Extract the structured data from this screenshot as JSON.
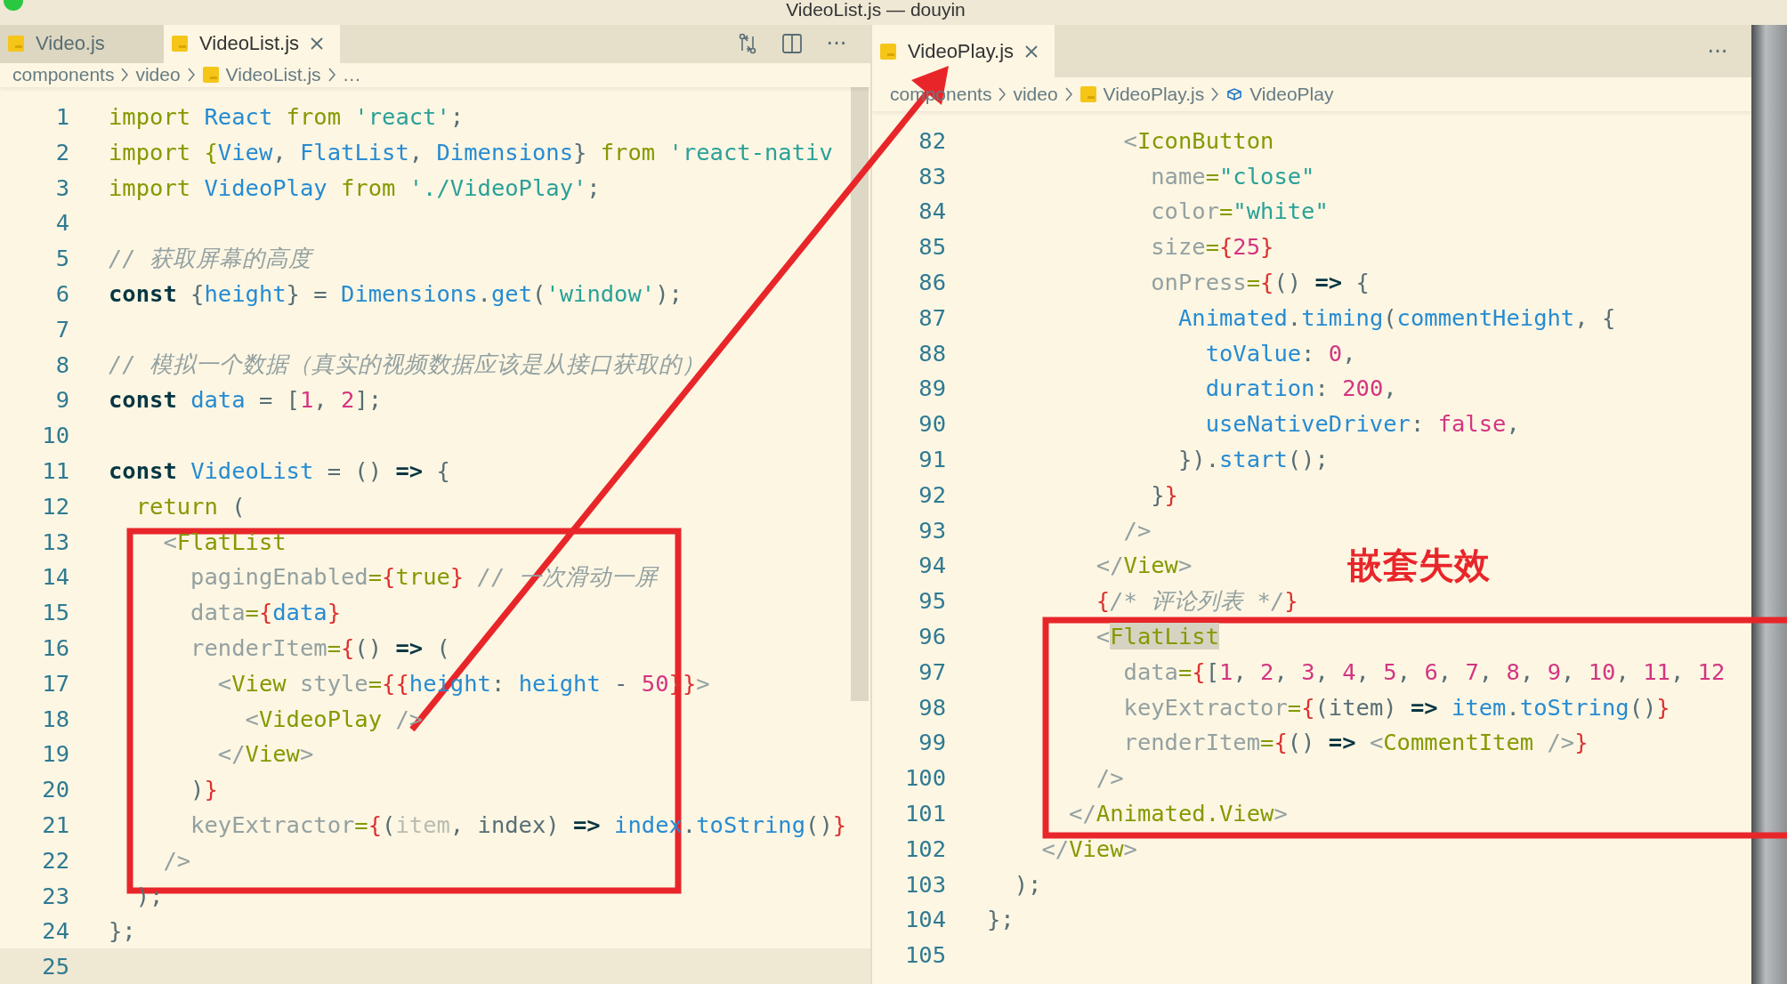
{
  "window": {
    "title": "VideoList.js — douyin"
  },
  "editors": [
    {
      "tabs": [
        {
          "label": "Video.js",
          "selected": false
        },
        {
          "label": "VideoList.js",
          "selected": true
        }
      ],
      "actions": [
        {
          "kind": "compare"
        },
        {
          "kind": "split"
        },
        {
          "kind": "more",
          "text": "···"
        }
      ],
      "breadcrumb": [
        {
          "text": "components",
          "kind": "folder"
        },
        {
          "text": "video",
          "kind": "folder"
        },
        {
          "text": "VideoList.js",
          "kind": "file"
        },
        {
          "text": "…",
          "kind": "more"
        }
      ],
      "lines": [
        {
          "number": "1",
          "tokens": [
            {
              "text": "import ",
              "kind": "kw"
            },
            {
              "text": "React ",
              "kind": "id"
            },
            {
              "text": "from ",
              "kind": "kw"
            },
            {
              "text": "'react'",
              "kind": "str"
            },
            {
              "text": ";",
              "kind": "pl"
            }
          ]
        },
        {
          "number": "2",
          "tokens": [
            {
              "text": "import {",
              "kind": "kw"
            },
            {
              "text": "View",
              "kind": "id"
            },
            {
              "text": ", ",
              "kind": "pl"
            },
            {
              "text": "FlatList",
              "kind": "id"
            },
            {
              "text": ", ",
              "kind": "pl"
            },
            {
              "text": "Dimensions",
              "kind": "id"
            },
            {
              "text": "} ",
              "kind": "pl"
            },
            {
              "text": "from ",
              "kind": "kw"
            },
            {
              "text": "'react-nativ",
              "kind": "str"
            }
          ]
        },
        {
          "number": "3",
          "tokens": [
            {
              "text": "import ",
              "kind": "kw"
            },
            {
              "text": "VideoPlay ",
              "kind": "id"
            },
            {
              "text": "from ",
              "kind": "kw"
            },
            {
              "text": "'./VideoPlay'",
              "kind": "str"
            },
            {
              "text": ";",
              "kind": "pl"
            }
          ]
        },
        {
          "number": "4"
        },
        {
          "number": "5",
          "tokens": [
            {
              "text": "// 获取屏幕的高度",
              "kind": "cm"
            }
          ]
        },
        {
          "number": "6",
          "tokens": [
            {
              "text": "const",
              "kind": "b"
            },
            {
              "text": " {",
              "kind": "pl"
            },
            {
              "text": "height",
              "kind": "id"
            },
            {
              "text": "} = ",
              "kind": "pl"
            },
            {
              "text": "Dimensions",
              "kind": "id"
            },
            {
              "text": ".",
              "kind": "pl"
            },
            {
              "text": "get",
              "kind": "id"
            },
            {
              "text": "(",
              "kind": "pl"
            },
            {
              "text": "'window'",
              "kind": "str"
            },
            {
              "text": ");",
              "kind": "pl"
            }
          ]
        },
        {
          "number": "7"
        },
        {
          "number": "8",
          "tokens": [
            {
              "text": "// 模拟一个数据（真实的视频数据应该是从接口获取的）",
              "kind": "cm"
            }
          ]
        },
        {
          "number": "9",
          "tokens": [
            {
              "text": "const ",
              "kind": "b"
            },
            {
              "text": "data",
              "kind": "id"
            },
            {
              "text": " = [",
              "kind": "pl"
            },
            {
              "text": "1",
              "kind": "num"
            },
            {
              "text": ", ",
              "kind": "pl"
            },
            {
              "text": "2",
              "kind": "num"
            },
            {
              "text": "];",
              "kind": "pl"
            }
          ]
        },
        {
          "number": "10"
        },
        {
          "number": "11",
          "tokens": [
            {
              "text": "const ",
              "kind": "b"
            },
            {
              "text": "VideoList",
              "kind": "id"
            },
            {
              "text": " = () ",
              "kind": "pl"
            },
            {
              "text": "=>",
              "kind": "b"
            },
            {
              "text": " {",
              "kind": "pl"
            }
          ]
        },
        {
          "number": "12",
          "tokens": [
            {
              "text": "  return",
              "kind": "kw"
            },
            {
              "text": " (",
              "kind": "pl"
            }
          ]
        },
        {
          "number": "13",
          "tokens": [
            {
              "text": "    <",
              "kind": "ang"
            },
            {
              "text": "FlatList",
              "kind": "tag"
            }
          ]
        },
        {
          "number": "14",
          "tokens": [
            {
              "text": "      pagingEnabled",
              "kind": "attr"
            },
            {
              "text": "=",
              "kind": "kw"
            },
            {
              "text": "{",
              "kind": "br"
            },
            {
              "text": "true",
              "kind": "kw"
            },
            {
              "text": "}",
              "kind": "br"
            },
            {
              "text": " // 一次滑动一屏",
              "kind": "cm"
            }
          ]
        },
        {
          "number": "15",
          "tokens": [
            {
              "text": "      data",
              "kind": "attr"
            },
            {
              "text": "=",
              "kind": "kw"
            },
            {
              "text": "{",
              "kind": "br"
            },
            {
              "text": "data",
              "kind": "id"
            },
            {
              "text": "}",
              "kind": "br"
            }
          ]
        },
        {
          "number": "16",
          "tokens": [
            {
              "text": "      renderItem",
              "kind": "attr"
            },
            {
              "text": "=",
              "kind": "kw"
            },
            {
              "text": "{",
              "kind": "br"
            },
            {
              "text": "() ",
              "kind": "pl"
            },
            {
              "text": "=>",
              "kind": "b"
            },
            {
              "text": " (",
              "kind": "pl"
            }
          ]
        },
        {
          "number": "17",
          "tokens": [
            {
              "text": "        <",
              "kind": "ang"
            },
            {
              "text": "View",
              "kind": "tag"
            },
            {
              "text": " style",
              "kind": "attr"
            },
            {
              "text": "=",
              "kind": "kw"
            },
            {
              "text": "{{",
              "kind": "br"
            },
            {
              "text": "height",
              "kind": "id"
            },
            {
              "text": ": ",
              "kind": "pl"
            },
            {
              "text": "height",
              "kind": "id"
            },
            {
              "text": " - ",
              "kind": "pl"
            },
            {
              "text": "50",
              "kind": "num"
            },
            {
              "text": "}}",
              "kind": "br"
            },
            {
              "text": ">",
              "kind": "ang"
            }
          ]
        },
        {
          "number": "18",
          "tokens": [
            {
              "text": "          <",
              "kind": "ang"
            },
            {
              "text": "VideoPlay",
              "kind": "tag"
            },
            {
              "text": " />",
              "kind": "ang"
            }
          ]
        },
        {
          "number": "19",
          "tokens": [
            {
              "text": "        </",
              "kind": "ang"
            },
            {
              "text": "View",
              "kind": "tag"
            },
            {
              "text": ">",
              "kind": "ang"
            }
          ]
        },
        {
          "number": "20",
          "tokens": [
            {
              "text": "      )",
              "kind": "pl"
            },
            {
              "text": "}",
              "kind": "br"
            }
          ]
        },
        {
          "number": "21",
          "tokens": [
            {
              "text": "      keyExtractor",
              "kind": "attr"
            },
            {
              "text": "=",
              "kind": "kw"
            },
            {
              "text": "{",
              "kind": "br"
            },
            {
              "text": "(",
              "kind": "pl"
            },
            {
              "text": "item",
              "kind": "dim"
            },
            {
              "text": ", index) ",
              "kind": "pl"
            },
            {
              "text": "=>",
              "kind": "b"
            },
            {
              "text": " index",
              "kind": "id"
            },
            {
              "text": ".",
              "kind": "pl"
            },
            {
              "text": "toString",
              "kind": "id"
            },
            {
              "text": "()",
              "kind": "pl"
            },
            {
              "text": "}",
              "kind": "br"
            }
          ]
        },
        {
          "number": "22",
          "tokens": [
            {
              "text": "    />",
              "kind": "ang"
            }
          ]
        },
        {
          "number": "23",
          "tokens": [
            {
              "text": "  );",
              "kind": "pl"
            }
          ]
        },
        {
          "number": "24",
          "tokens": [
            {
              "text": "};",
              "kind": "pl"
            }
          ]
        },
        {
          "number": "25",
          "current": true
        }
      ]
    },
    {
      "tabs": [
        {
          "label": "VideoPlay.js",
          "selected": true
        }
      ],
      "actions": [
        {
          "kind": "more",
          "text": "···"
        }
      ],
      "breadcrumb": [
        {
          "text": "components",
          "kind": "folder"
        },
        {
          "text": "video",
          "kind": "folder"
        },
        {
          "text": "VideoPlay.js",
          "kind": "file"
        },
        {
          "text": "VideoPlay",
          "kind": "symbol"
        }
      ],
      "lines": [
        {
          "number": "82",
          "tokens": [
            {
              "text": "          <",
              "kind": "ang"
            },
            {
              "text": "IconButton",
              "kind": "tag"
            }
          ]
        },
        {
          "number": "83",
          "tokens": [
            {
              "text": "            name",
              "kind": "attr"
            },
            {
              "text": "=",
              "kind": "kw"
            },
            {
              "text": "\"close\"",
              "kind": "str"
            }
          ]
        },
        {
          "number": "84",
          "tokens": [
            {
              "text": "            color",
              "kind": "attr"
            },
            {
              "text": "=",
              "kind": "kw"
            },
            {
              "text": "\"white\"",
              "kind": "str"
            }
          ]
        },
        {
          "number": "85",
          "tokens": [
            {
              "text": "            size",
              "kind": "attr"
            },
            {
              "text": "=",
              "kind": "kw"
            },
            {
              "text": "{",
              "kind": "br"
            },
            {
              "text": "25",
              "kind": "num"
            },
            {
              "text": "}",
              "kind": "br"
            }
          ]
        },
        {
          "number": "86",
          "tokens": [
            {
              "text": "            onPress",
              "kind": "attr"
            },
            {
              "text": "=",
              "kind": "kw"
            },
            {
              "text": "{",
              "kind": "br"
            },
            {
              "text": "() ",
              "kind": "pl"
            },
            {
              "text": "=>",
              "kind": "b"
            },
            {
              "text": " {",
              "kind": "pl"
            }
          ]
        },
        {
          "number": "87",
          "tokens": [
            {
              "text": "              Animated",
              "kind": "id"
            },
            {
              "text": ".",
              "kind": "pl"
            },
            {
              "text": "timing",
              "kind": "id"
            },
            {
              "text": "(",
              "kind": "pl"
            },
            {
              "text": "commentHeight",
              "kind": "id"
            },
            {
              "text": ", {",
              "kind": "pl"
            }
          ]
        },
        {
          "number": "88",
          "tokens": [
            {
              "text": "                toValue",
              "kind": "id"
            },
            {
              "text": ": ",
              "kind": "pl"
            },
            {
              "text": "0",
              "kind": "num"
            },
            {
              "text": ",",
              "kind": "pl"
            }
          ]
        },
        {
          "number": "89",
          "tokens": [
            {
              "text": "                duration",
              "kind": "id"
            },
            {
              "text": ": ",
              "kind": "pl"
            },
            {
              "text": "200",
              "kind": "num"
            },
            {
              "text": ",",
              "kind": "pl"
            }
          ]
        },
        {
          "number": "90",
          "tokens": [
            {
              "text": "                useNativeDriver",
              "kind": "id"
            },
            {
              "text": ": ",
              "kind": "pl"
            },
            {
              "text": "false",
              "kind": "num"
            },
            {
              "text": ",",
              "kind": "pl"
            }
          ]
        },
        {
          "number": "91",
          "tokens": [
            {
              "text": "              }).",
              "kind": "pl"
            },
            {
              "text": "start",
              "kind": "id"
            },
            {
              "text": "();",
              "kind": "pl"
            }
          ]
        },
        {
          "number": "92",
          "tokens": [
            {
              "text": "            }",
              "kind": "pl"
            },
            {
              "text": "}",
              "kind": "br"
            }
          ]
        },
        {
          "number": "93",
          "tokens": [
            {
              "text": "          />",
              "kind": "ang"
            }
          ]
        },
        {
          "number": "94",
          "tokens": [
            {
              "text": "        </",
              "kind": "ang"
            },
            {
              "text": "View",
              "kind": "tag"
            },
            {
              "text": ">",
              "kind": "ang"
            }
          ]
        },
        {
          "number": "95",
          "tokens": [
            {
              "text": "        {",
              "kind": "br"
            },
            {
              "text": "/* 评论列表 */",
              "kind": "cm"
            },
            {
              "text": "}",
              "kind": "br"
            }
          ]
        },
        {
          "number": "96",
          "tokens": [
            {
              "text": "        <",
              "kind": "ang"
            },
            {
              "text": "FlatList",
              "kind": "match"
            }
          ]
        },
        {
          "number": "97",
          "tokens": [
            {
              "text": "          data",
              "kind": "attr"
            },
            {
              "text": "=",
              "kind": "kw"
            },
            {
              "text": "{",
              "kind": "br"
            },
            {
              "text": "[",
              "kind": "pl"
            },
            {
              "text": "1",
              "kind": "num"
            },
            {
              "text": ", ",
              "kind": "pl"
            },
            {
              "text": "2",
              "kind": "num"
            },
            {
              "text": ", ",
              "kind": "pl"
            },
            {
              "text": "3",
              "kind": "num"
            },
            {
              "text": ", ",
              "kind": "pl"
            },
            {
              "text": "4",
              "kind": "num"
            },
            {
              "text": ", ",
              "kind": "pl"
            },
            {
              "text": "5",
              "kind": "num"
            },
            {
              "text": ", ",
              "kind": "pl"
            },
            {
              "text": "6",
              "kind": "num"
            },
            {
              "text": ", ",
              "kind": "pl"
            },
            {
              "text": "7",
              "kind": "num"
            },
            {
              "text": ", ",
              "kind": "pl"
            },
            {
              "text": "8",
              "kind": "num"
            },
            {
              "text": ", ",
              "kind": "pl"
            },
            {
              "text": "9",
              "kind": "num"
            },
            {
              "text": ", ",
              "kind": "pl"
            },
            {
              "text": "10",
              "kind": "num"
            },
            {
              "text": ", ",
              "kind": "pl"
            },
            {
              "text": "11",
              "kind": "num"
            },
            {
              "text": ", ",
              "kind": "pl"
            },
            {
              "text": "12",
              "kind": "num"
            }
          ]
        },
        {
          "number": "98",
          "tokens": [
            {
              "text": "          keyExtractor",
              "kind": "attr"
            },
            {
              "text": "=",
              "kind": "kw"
            },
            {
              "text": "{",
              "kind": "br"
            },
            {
              "text": "(item) ",
              "kind": "pl"
            },
            {
              "text": "=>",
              "kind": "b"
            },
            {
              "text": " item",
              "kind": "id"
            },
            {
              "text": ".",
              "kind": "pl"
            },
            {
              "text": "toString",
              "kind": "id"
            },
            {
              "text": "()",
              "kind": "pl"
            },
            {
              "text": "}",
              "kind": "br"
            }
          ]
        },
        {
          "number": "99",
          "tokens": [
            {
              "text": "          renderItem",
              "kind": "attr"
            },
            {
              "text": "=",
              "kind": "kw"
            },
            {
              "text": "{",
              "kind": "br"
            },
            {
              "text": "() ",
              "kind": "pl"
            },
            {
              "text": "=>",
              "kind": "b"
            },
            {
              "text": " <",
              "kind": "ang"
            },
            {
              "text": "CommentItem",
              "kind": "tag"
            },
            {
              "text": " />",
              "kind": "ang"
            },
            {
              "text": "}",
              "kind": "br"
            }
          ]
        },
        {
          "number": "100",
          "tokens": [
            {
              "text": "        />",
              "kind": "ang"
            }
          ]
        },
        {
          "number": "101",
          "tokens": [
            {
              "text": "      </",
              "kind": "ang"
            },
            {
              "text": "Animated.View",
              "kind": "tag"
            },
            {
              "text": ">",
              "kind": "ang"
            }
          ]
        },
        {
          "number": "102",
          "tokens": [
            {
              "text": "    </",
              "kind": "ang"
            },
            {
              "text": "View",
              "kind": "tag"
            },
            {
              "text": ">",
              "kind": "ang"
            }
          ]
        },
        {
          "number": "103",
          "tokens": [
            {
              "text": "  );",
              "kind": "pl"
            }
          ]
        },
        {
          "number": "104",
          "tokens": [
            {
              "text": "};",
              "kind": "pl"
            }
          ]
        },
        {
          "number": "105"
        }
      ]
    }
  ],
  "annotations": [
    {
      "kind": "box"
    },
    {
      "kind": "box"
    },
    {
      "kind": "arrow"
    },
    {
      "kind": "label",
      "text": "嵌套失效"
    }
  ]
}
